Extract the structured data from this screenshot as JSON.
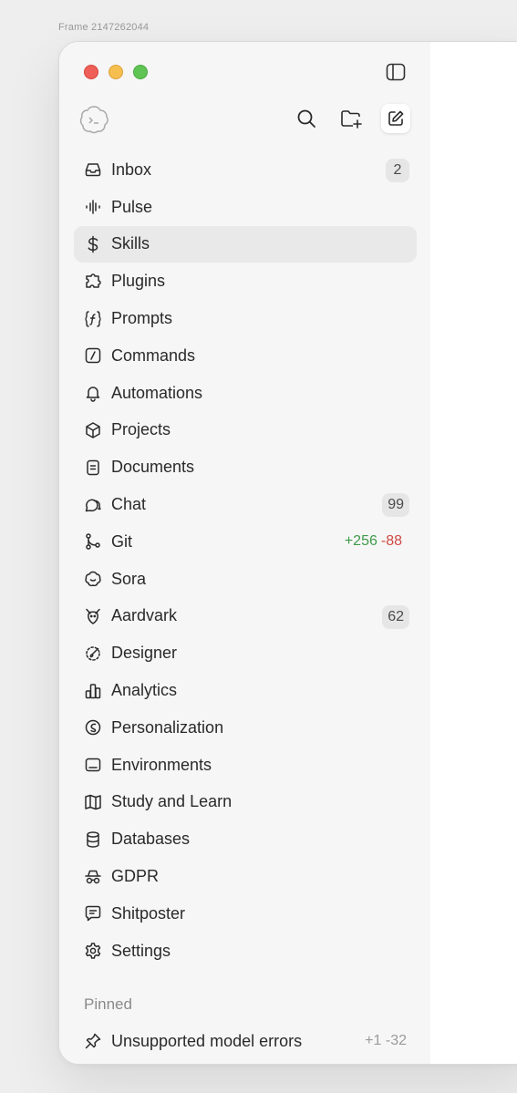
{
  "frame_label": "Frame 2147262044",
  "toolbar": {
    "search_icon": "search-icon",
    "new_folder_icon": "folder-plus-icon",
    "compose_icon": "compose-icon"
  },
  "nav": {
    "items": [
      {
        "label": "Inbox",
        "icon": "inbox-icon",
        "badge": "2"
      },
      {
        "label": "Pulse",
        "icon": "waveform-icon"
      },
      {
        "label": "Skills",
        "icon": "dollar-icon",
        "active": true
      },
      {
        "label": "Plugins",
        "icon": "puzzle-icon"
      },
      {
        "label": "Prompts",
        "icon": "function-icon"
      },
      {
        "label": "Commands",
        "icon": "slash-icon"
      },
      {
        "label": "Automations",
        "icon": "bell-icon"
      },
      {
        "label": "Projects",
        "icon": "cube-icon"
      },
      {
        "label": "Documents",
        "icon": "document-icon"
      },
      {
        "label": "Chat",
        "icon": "chat-icon",
        "badge": "99"
      },
      {
        "label": "Git",
        "icon": "git-branch-icon",
        "additions": "+256",
        "deletions": "-88"
      },
      {
        "label": "Sora",
        "icon": "sora-icon"
      },
      {
        "label": "Aardvark",
        "icon": "aardvark-icon",
        "badge": "62"
      },
      {
        "label": "Designer",
        "icon": "designer-icon"
      },
      {
        "label": "Analytics",
        "icon": "bar-chart-icon"
      },
      {
        "label": "Personalization",
        "icon": "personalization-icon"
      },
      {
        "label": "Environments",
        "icon": "laptop-icon"
      },
      {
        "label": "Study and Learn",
        "icon": "book-icon"
      },
      {
        "label": "Databases",
        "icon": "database-icon"
      },
      {
        "label": "GDPR",
        "icon": "incognito-icon"
      },
      {
        "label": "Shitposter",
        "icon": "message-icon"
      },
      {
        "label": "Settings",
        "icon": "gear-icon"
      }
    ]
  },
  "pinned": {
    "header": "Pinned",
    "items": [
      {
        "label": "Unsupported model errors",
        "icon": "pin-icon",
        "additions": "+1",
        "deletions": "-32"
      }
    ]
  }
}
